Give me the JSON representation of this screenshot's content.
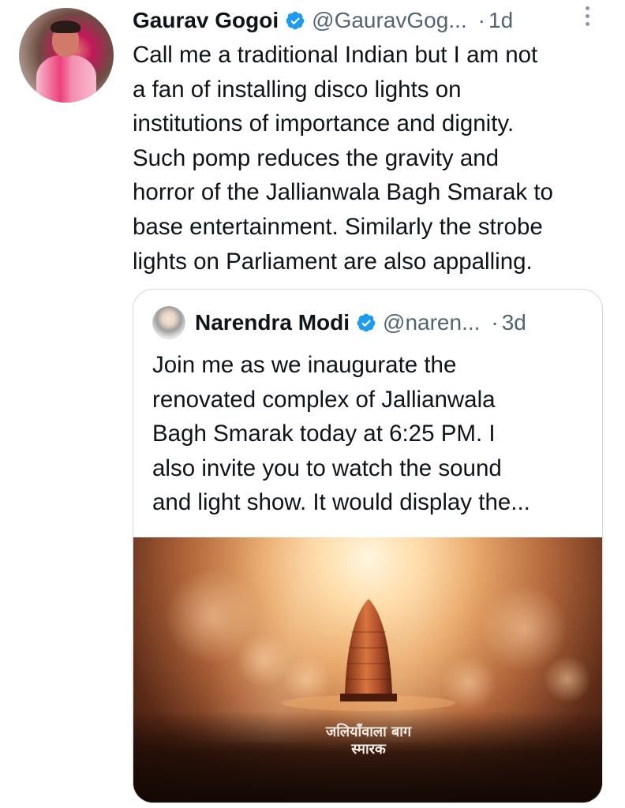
{
  "tweet": {
    "author_name": "Gaurav Gogoi",
    "handle": "@GauravGog...",
    "separator": "·",
    "time": "1d",
    "text_lines": [
      "Call me a traditional Indian but I am not",
      "a fan of installing disco lights on",
      "institutions of importance and dignity.",
      "Such pomp reduces the gravity and",
      "horror of the Jallianwala Bagh Smarak to",
      "base entertainment. Similarly the strobe",
      "lights on Parliament are also appalling."
    ]
  },
  "quoted_tweet": {
    "author_name": "Narendra Modi",
    "handle": "@naren...",
    "separator": "·",
    "time": "3d",
    "text_lines": [
      "Join me as we inaugurate the",
      "renovated complex of Jallianwala",
      "Bagh Smarak today at 6:25 PM. I",
      "also invite you to watch the sound",
      "and light show. It would display the..."
    ],
    "media": {
      "caption_line1": "जलियाँवाला बाग",
      "caption_line2": "स्मारक"
    }
  },
  "colors": {
    "verified_badge": "#1d9bf0",
    "secondary_text": "#536471",
    "border": "#cfd9de"
  },
  "icons": {
    "verified": "verified-badge-icon",
    "more": "more-vertical-icon"
  }
}
